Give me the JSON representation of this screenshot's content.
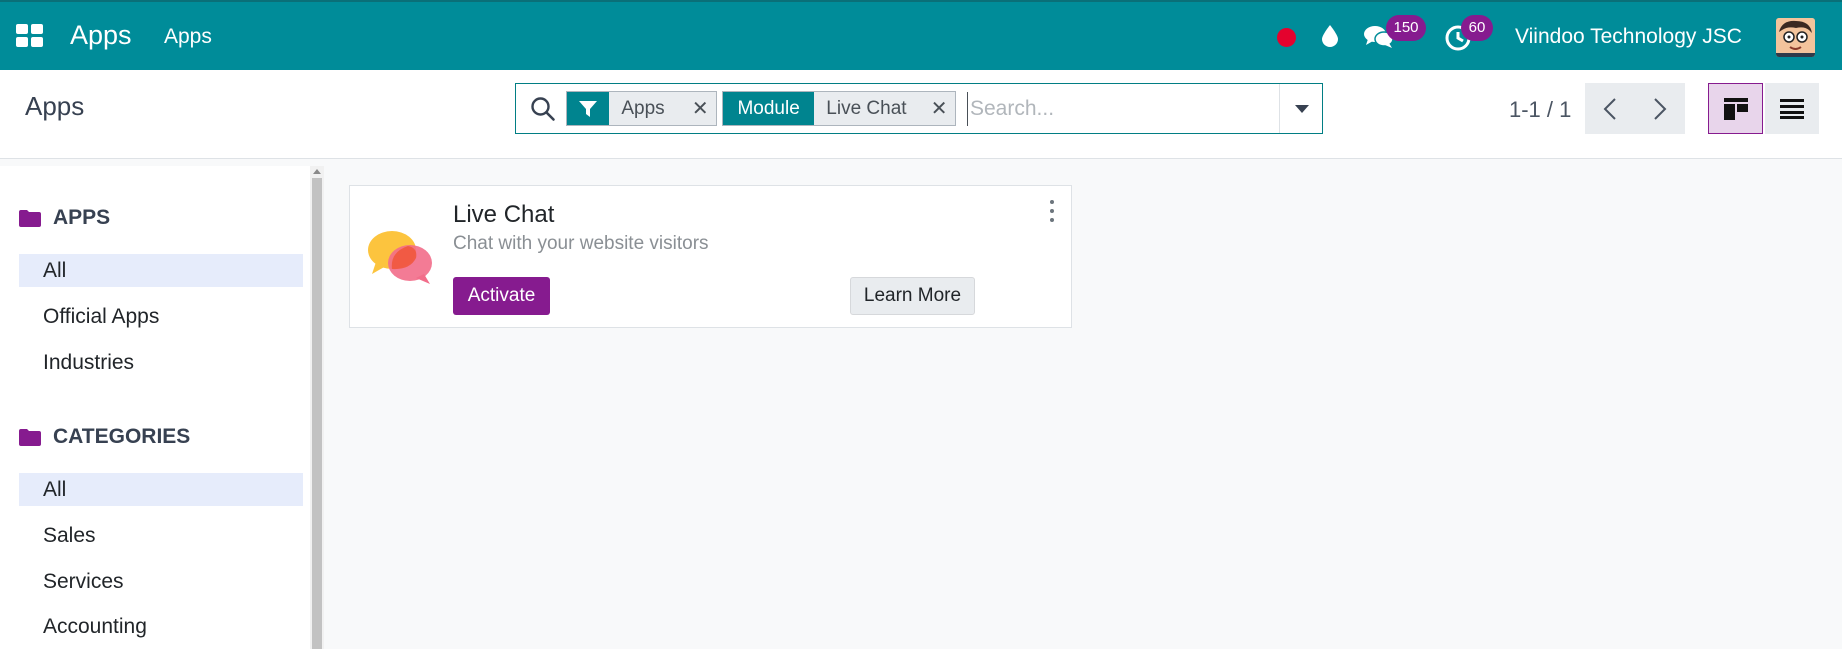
{
  "navbar": {
    "brand": "Apps",
    "menu_item": "Apps",
    "company": "Viindoo Technology JSC",
    "messages_badge": "150",
    "activities_badge": "60",
    "colors": {
      "background": "#008c99",
      "badge": "#861b8f",
      "status_dot": "#e4022e"
    }
  },
  "control_panel": {
    "title": "Apps",
    "search": {
      "placeholder": "Search...",
      "facets": [
        {
          "icon": "filter-icon",
          "value": "Apps"
        },
        {
          "label": "Module",
          "value": "Live Chat"
        }
      ]
    },
    "pager": "1-1 / 1",
    "views": [
      "kanban",
      "list"
    ],
    "active_view": "kanban"
  },
  "sidebar": {
    "apps_header": "APPS",
    "apps_items": [
      "All",
      "Official Apps",
      "Industries"
    ],
    "categories_header": "CATEGORIES",
    "category_items": [
      "All",
      "Sales",
      "Services",
      "Accounting"
    ],
    "active_apps_item": "All",
    "active_category_item": "All"
  },
  "cards": [
    {
      "name": "Live Chat",
      "summary": "Chat with your website visitors",
      "activate_label": "Activate",
      "learn_more_label": "Learn More",
      "icon": "live-chat-bubbles-icon"
    }
  ]
}
